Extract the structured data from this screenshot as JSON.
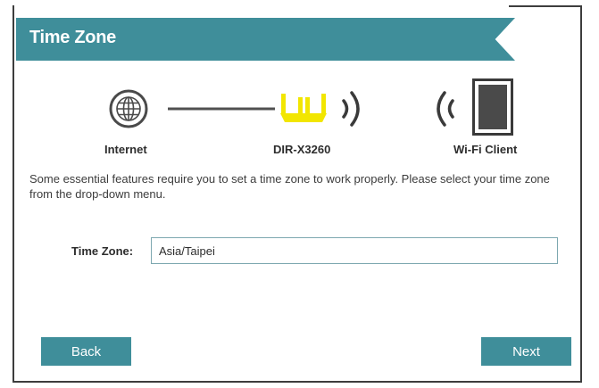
{
  "header": {
    "title": "Time Zone"
  },
  "diagram": {
    "internet_label": "Internet",
    "router_label": "DIR-X3260",
    "client_label": "Wi-Fi Client",
    "icons": [
      "globe-icon",
      "router-icon",
      "wifi-waves-icon",
      "tablet-icon"
    ]
  },
  "description": "Some essential features require you to set a time zone to work properly. Please select your time zone from the drop-down menu.",
  "form": {
    "time_zone_label": "Time Zone:",
    "time_zone_value": "Asia/Taipei"
  },
  "buttons": {
    "back_label": "Back",
    "next_label": "Next"
  },
  "colors": {
    "accent": "#3f8e9a",
    "router": "#f2e600"
  }
}
